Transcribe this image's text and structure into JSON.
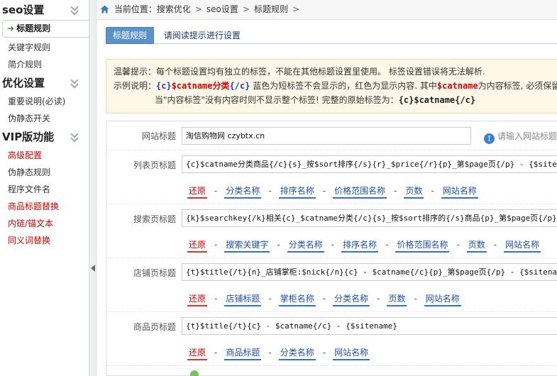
{
  "sidebar": {
    "sections": [
      {
        "title": "seo设置",
        "items": [
          {
            "label": "标题规则",
            "active": true,
            "red": false
          },
          {
            "label": "关键字规则",
            "active": false,
            "red": false
          },
          {
            "label": "简介规则",
            "active": false,
            "red": false
          }
        ]
      },
      {
        "title": "优化设置",
        "items": [
          {
            "label": "重要说明(必读)",
            "active": false,
            "red": false
          },
          {
            "label": "伪静态开关",
            "active": false,
            "red": false
          }
        ]
      },
      {
        "title": "VIP版功能",
        "items": [
          {
            "label": "高级配置",
            "active": false,
            "red": true
          },
          {
            "label": "伪静态规则",
            "active": false,
            "red": false
          },
          {
            "label": "程序文件名",
            "active": false,
            "red": false
          },
          {
            "label": "商品标题替换",
            "active": false,
            "red": true
          },
          {
            "label": "内链/锚文本",
            "active": false,
            "red": true
          },
          {
            "label": "同义词替换",
            "active": false,
            "red": true
          }
        ]
      }
    ]
  },
  "breadcrumb": {
    "prefix": "当前位置：",
    "parts": [
      "搜索优化",
      "seo设置",
      "标题规则"
    ],
    "trailing": ">"
  },
  "tabs": {
    "active": "标题规则",
    "hint": "请阅读提示进行设置"
  },
  "notice": {
    "line1": "温馨提示：每个标题设置均有独立的标签，不能在其他标题设置里使用。 标签设置错误将无法解析.",
    "line2_prefix": "示例说明：",
    "line2_blue1": "{c}",
    "line2_red1": "$catname分类",
    "line2_blue2": "{/c}",
    "line2_mid": " 蓝色为短标签不会显示的，红色为显示内容. 其中",
    "line2_red2": "$catname",
    "line2_suffix": "为内容标签, 必须保留",
    "line3_prefix": "当\"内容标签\"没有内容时则不显示整个标签!   完整的原始标签为：",
    "line3_code": "{c}$catname{/c}"
  },
  "form": {
    "site": {
      "label": "网站标题",
      "value": "淘信购物网 czybtx.cn",
      "hint": "请输入网站标题"
    },
    "list": {
      "label": "列表页标题",
      "value": "{c}$catname分类商品{/c}{s}_按$sort排序{/s}{r}_$price{/r}{p}_第$page页{/p} - {$sitename}",
      "links": [
        "还原",
        "分类名称",
        "排序名称",
        "价格范围名称",
        "页数",
        "网站名称"
      ]
    },
    "search": {
      "label": "搜索页标题",
      "value": "{k}$searchkey{/k}相关{c}_$catname分类{/c}{s}_按$sort排序的{/s}商品{p}_第$page页{/p} - {$",
      "links": [
        "还原",
        "搜索关键字",
        "分类名称",
        "排序名称",
        "价格范围名称",
        "页数",
        "网站名称"
      ]
    },
    "shop": {
      "label": "店铺页标题",
      "value": "{t}$title{/t}{n}_店铺掌柜:$nick{/n}{c} - $catname{/c}{p}_第$page页{/p} - {$sitename}",
      "links": [
        "还原",
        "店铺标题",
        "掌柜名称",
        "分类名称",
        "页数",
        "网站名称"
      ]
    },
    "item": {
      "label": "商品页标题",
      "value": "{t}$title{/t}{c} - $catname{/c} - {$sitename}",
      "links": [
        "还原",
        "商品标题",
        "分类名称",
        "网站名称"
      ]
    },
    "separator": "-"
  },
  "colors": {
    "tab_active": "#5d91cc",
    "link_blue": "#1e4fa8",
    "link_red": "#cc0000",
    "notice_bg": "#fff8e9"
  }
}
